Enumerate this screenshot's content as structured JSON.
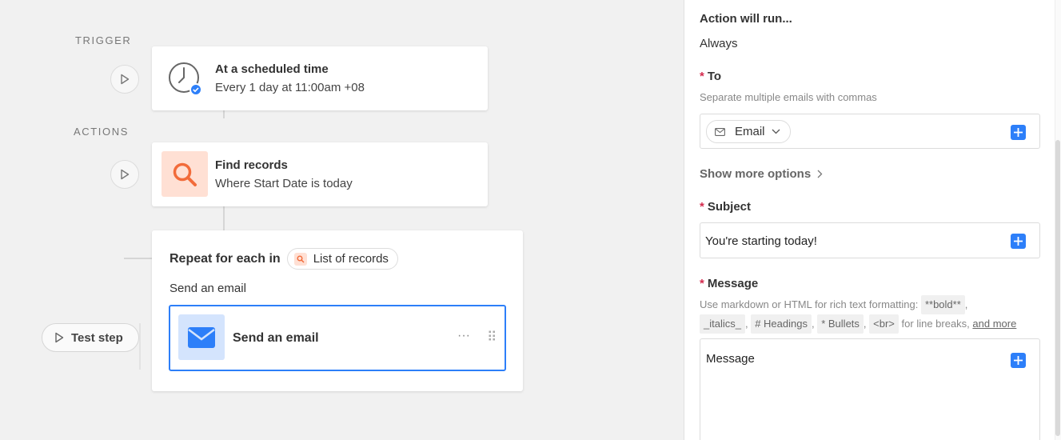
{
  "canvas": {
    "trigger_label": "TRIGGER",
    "actions_label": "ACTIONS",
    "trigger_card": {
      "title": "At a scheduled time",
      "subtitle": "Every 1 day at 11:00am +08",
      "icon": "clock-icon"
    },
    "find_card": {
      "title": "Find records",
      "subtitle": "Where Start Date is today",
      "icon": "search-icon"
    },
    "repeat_card": {
      "title": "Repeat for each in",
      "list_chip": "List of records",
      "step_label": "Send an email",
      "inner_step": {
        "title": "Send an email",
        "icon": "envelope-icon",
        "more": "···",
        "drag": "⠿"
      }
    },
    "test_step_label": "Test step"
  },
  "panel": {
    "run_label": "Action will run...",
    "run_value": "Always",
    "to": {
      "label": "To",
      "help": "Separate multiple emails with commas",
      "chip": "Email"
    },
    "show_more": "Show more options",
    "subject": {
      "label": "Subject",
      "value": "You're starting today!"
    },
    "message": {
      "label": "Message",
      "help_prefix": "Use markdown or HTML for rich text formatting:",
      "code_bold": "**bold**",
      "code_italics": "_italics_",
      "code_headings": "# Headings",
      "code_bullets": "* Bullets",
      "code_br": "<br>",
      "help_linebreaks": "for line breaks,",
      "and_more": "and more",
      "value": "Message"
    }
  },
  "colors": {
    "accent_blue": "#2d7ff9",
    "find_orange": "#f26b3a",
    "required_red": "#d42b4e"
  }
}
